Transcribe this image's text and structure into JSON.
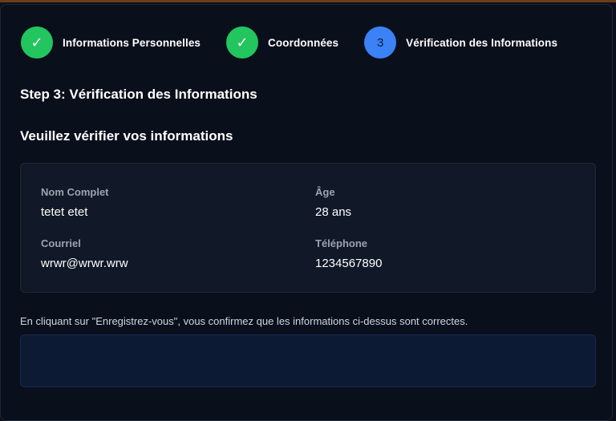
{
  "stepper": {
    "steps": [
      {
        "label": "Informations Personnelles",
        "icon": "✓",
        "state": "done"
      },
      {
        "label": "Coordonnées",
        "icon": "✓",
        "state": "done"
      },
      {
        "label": "Vérification des Informations",
        "number": "3",
        "state": "active"
      }
    ]
  },
  "page": {
    "step_title": "Step 3: Vérification des Informations",
    "section_title": "Veuillez vérifier vos informations"
  },
  "info": {
    "full_name_label": "Nom Complet",
    "full_name_value": "tetet etet",
    "age_label": "Âge",
    "age_value": "28 ans",
    "email_label": "Courriel",
    "email_value": "wrwr@wrwr.wrw",
    "phone_label": "Téléphone",
    "phone_value": "1234567890"
  },
  "confirm_text": "En cliquant sur \"Enregistrez-vous\", vous confirmez que les informations ci-dessus sont correctes.",
  "colors": {
    "done": "#22c55e",
    "active": "#3b82f6",
    "background": "#0a0f1c"
  }
}
